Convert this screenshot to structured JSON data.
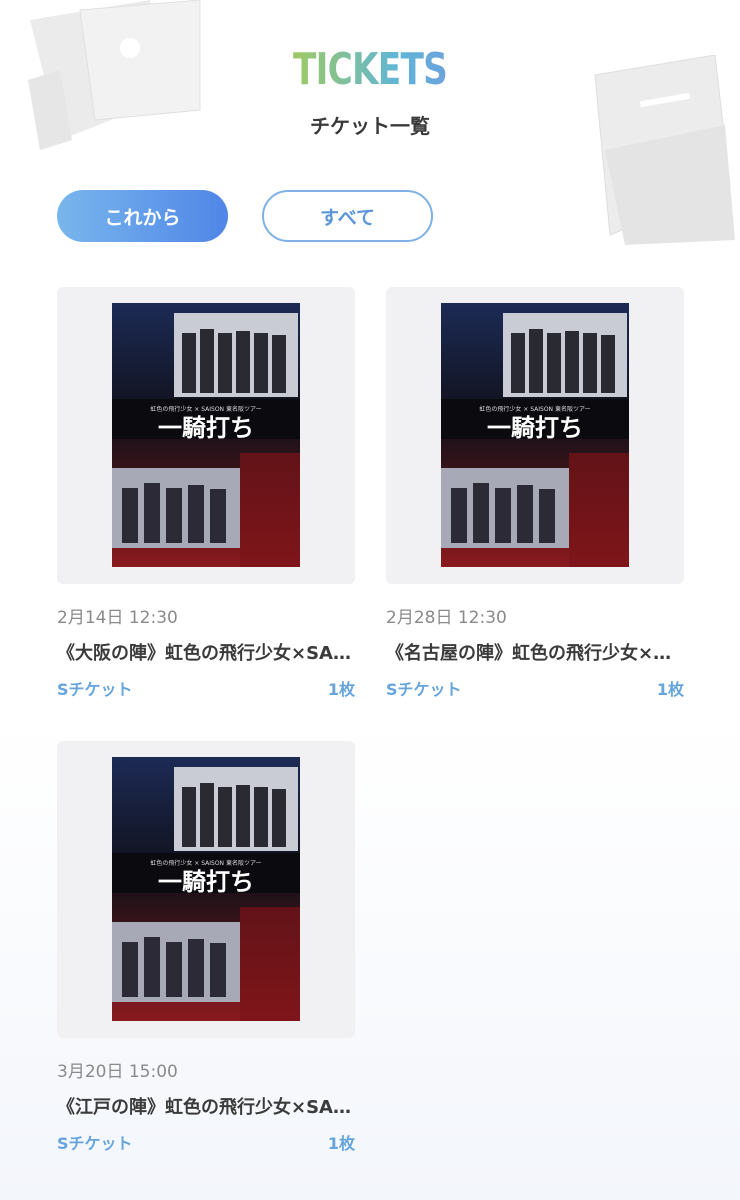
{
  "header": {
    "logo_text": "TICKETS",
    "subtitle": "チケット一覧"
  },
  "tabs": {
    "upcoming_label": "これから",
    "all_label": "すべて",
    "active": "upcoming"
  },
  "tickets": [
    {
      "date": "2月14日 12:30",
      "title": "《大阪の陣》虹色の飛行少女×SAISON 東名阪ツアー「一騎打ち」",
      "type": "Sチケット",
      "count": "1枚",
      "poster": {
        "headline": "虹色の飛行少女 × SAISON 東名阪ツアー",
        "main_title": "一騎打ち"
      }
    },
    {
      "date": "2月28日 12:30",
      "title": "《名古屋の陣》虹色の飛行少女×SAISON 東名阪ツアー「一騎打ち」",
      "type": "Sチケット",
      "count": "1枚",
      "poster": {
        "headline": "虹色の飛行少女 × SAISON 東名阪ツアー",
        "main_title": "一騎打ち"
      }
    },
    {
      "date": "3月20日 15:00",
      "title": "《江戸の陣》虹色の飛行少女×SAISON 東名阪ツアー「一騎打ち」",
      "type": "Sチケット",
      "count": "1枚",
      "poster": {
        "headline": "虹色の飛行少女 × SAISON 東名阪ツアー",
        "main_title": "一騎打ち"
      }
    }
  ],
  "colors": {
    "accent": "#66a4dc",
    "tab_gradient_start": "#79b6ec",
    "tab_gradient_end": "#4f86e8",
    "poster_top": "#1c2a55",
    "poster_bottom": "#8a1a1e"
  }
}
